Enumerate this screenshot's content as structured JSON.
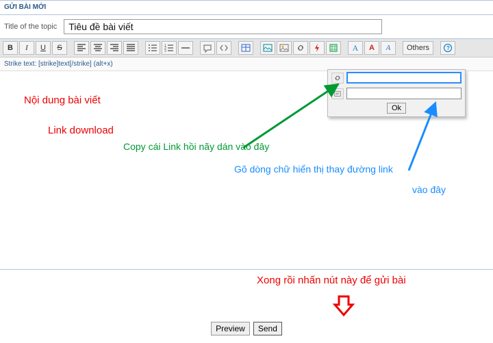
{
  "header": {
    "title": "GỬI BÀI MỚI"
  },
  "titleRow": {
    "label": "Title of the topic",
    "value": "Tiêu đề bài viết"
  },
  "hint": "Strike text: [strike]text[/strike] (alt+x)",
  "toolbar": {
    "others": "Others"
  },
  "popup": {
    "ok": "Ok",
    "field1": "",
    "field2": ""
  },
  "annotations": {
    "content": "Nội dung bài viết",
    "linkdl": "Link download",
    "green": "Copy cái Link hồi nãy dán vào đây",
    "blue1": "Gõ dòng chữ hiển thị thay đường link",
    "blue2": "vào đây",
    "footer": "Xong rồi nhấn nút này để gửi bài"
  },
  "buttons": {
    "preview": "Preview",
    "send": "Send"
  }
}
